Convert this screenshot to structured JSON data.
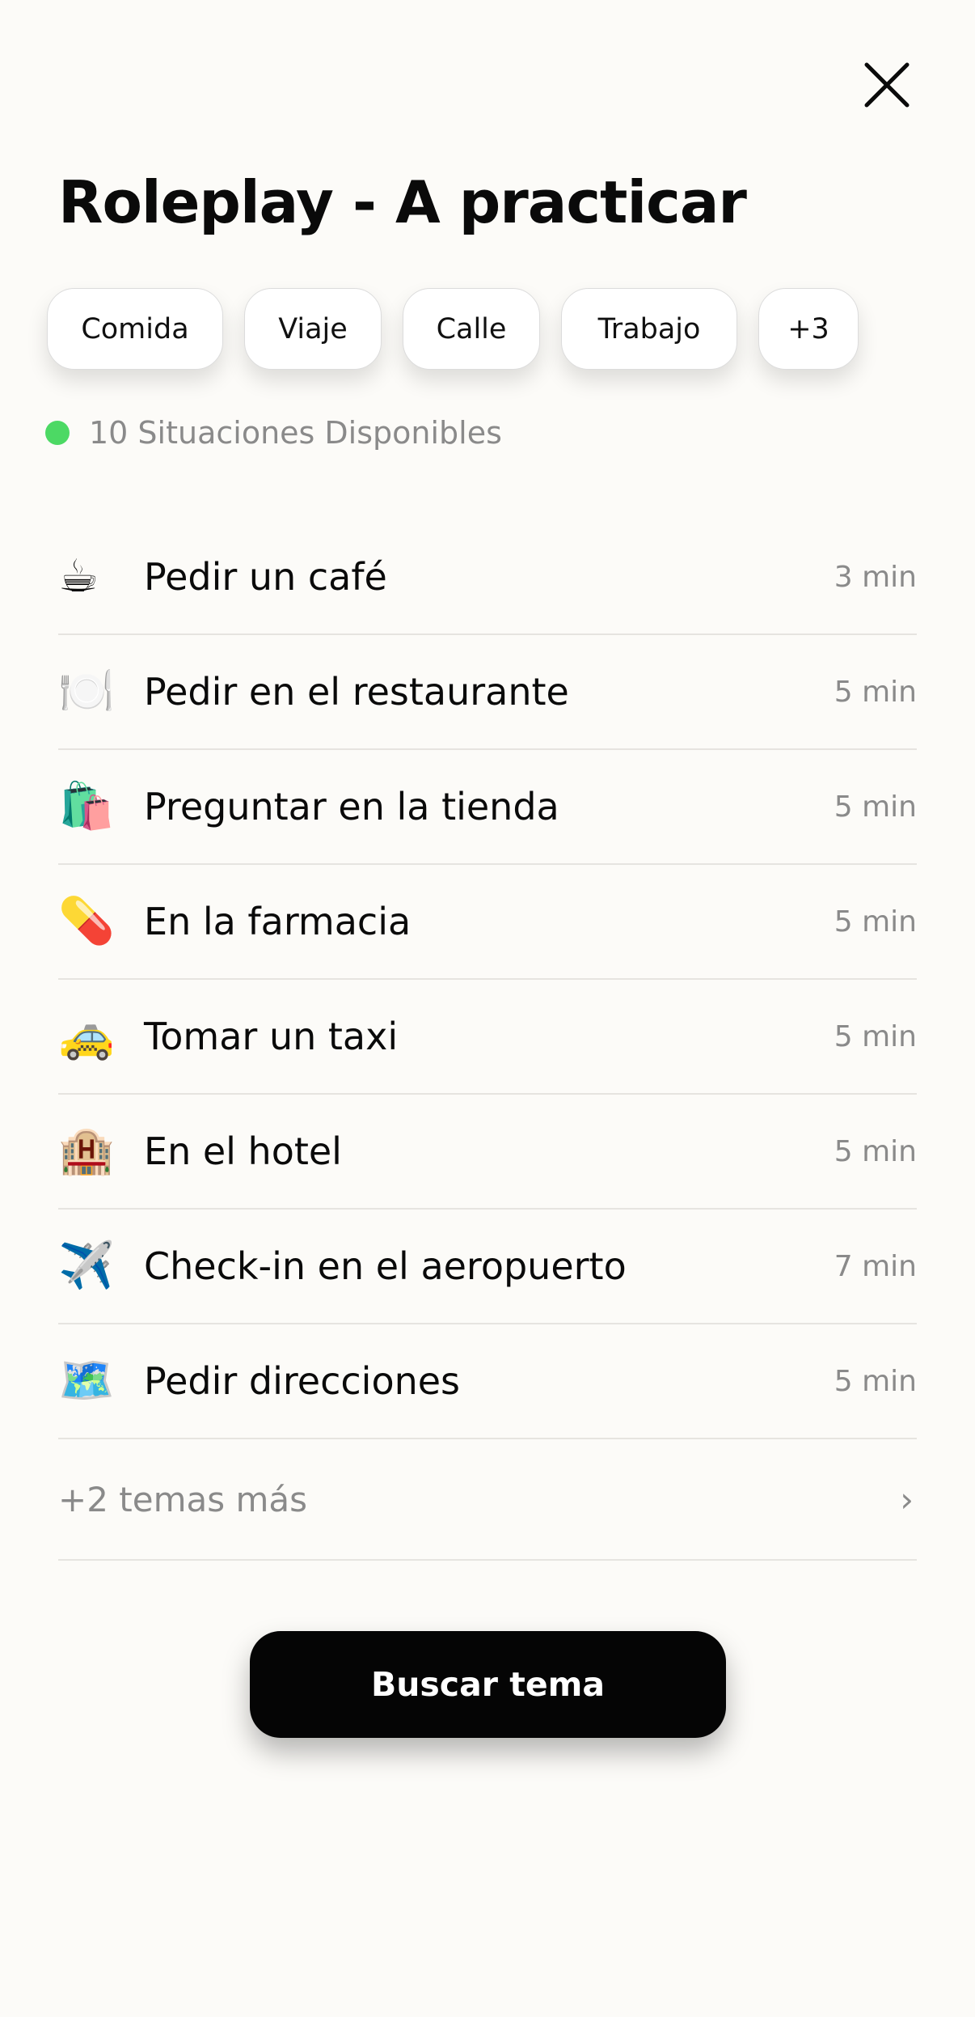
{
  "header": {
    "title": "Roleplay - A practicar",
    "close_icon": "close-icon"
  },
  "chips": [
    {
      "label": "Comida"
    },
    {
      "label": "Viaje"
    },
    {
      "label": "Calle"
    },
    {
      "label": "Trabajo"
    },
    {
      "label": "+3"
    }
  ],
  "status": {
    "text": "10 Situaciones Disponibles",
    "dot_color": "#4cd964"
  },
  "situations": [
    {
      "icon": "☕",
      "icon_name": "coffee-icon",
      "label": "Pedir un café",
      "duration": "3 min"
    },
    {
      "icon": "🍽️",
      "icon_name": "plate-cutlery-icon",
      "label": "Pedir en el restaurante",
      "duration": "5 min"
    },
    {
      "icon": "🛍️",
      "icon_name": "shopping-bags-icon",
      "label": "Preguntar en la tienda",
      "duration": "5 min"
    },
    {
      "icon": "💊",
      "icon_name": "pill-icon",
      "label": "En la farmacia",
      "duration": "5 min"
    },
    {
      "icon": "🚕",
      "icon_name": "taxi-icon",
      "label": "Tomar un taxi",
      "duration": "5 min"
    },
    {
      "icon": "🏨",
      "icon_name": "hotel-icon",
      "label": "En el hotel",
      "duration": "5 min"
    },
    {
      "icon": "✈️",
      "icon_name": "airplane-icon",
      "label": "Check-in en el aeropuerto",
      "duration": "7 min"
    },
    {
      "icon": "🗺️",
      "icon_name": "map-icon",
      "label": "Pedir direcciones",
      "duration": "5 min"
    }
  ],
  "more": {
    "label": "+2 temas más",
    "chevron": "›"
  },
  "primary_button": {
    "label": "Buscar tema",
    "background": "#050505"
  }
}
